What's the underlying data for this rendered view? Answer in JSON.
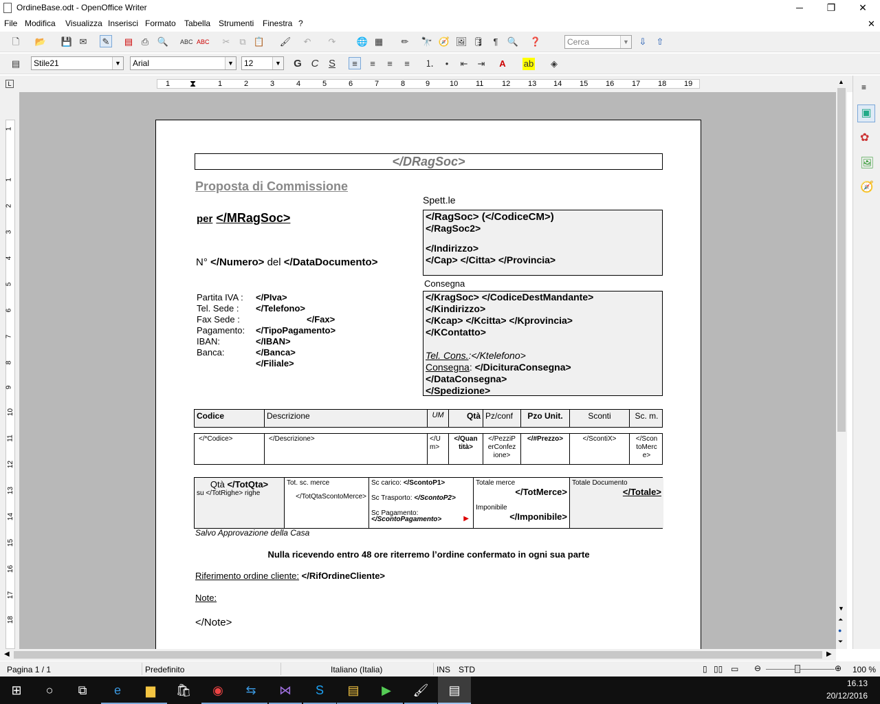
{
  "window": {
    "title": "OrdineBase.odt - OpenOffice Writer",
    "minimize": "─",
    "restore": "❐",
    "close": "✕",
    "doc_close": "✕"
  },
  "menu": [
    {
      "label": "File"
    },
    {
      "label": "Modifica"
    },
    {
      "label": "Visualizza"
    },
    {
      "label": "Inserisci"
    },
    {
      "label": "Formato"
    },
    {
      "label": "Tabella"
    },
    {
      "label": "Strumenti"
    },
    {
      "label": "Finestra"
    },
    {
      "label": "?"
    }
  ],
  "toolbar1": {
    "search_placeholder": "Cerca"
  },
  "toolbar2": {
    "style_value": "Stile21",
    "font_value": "Arial",
    "size_value": "12",
    "bold": "G",
    "italic": "C",
    "underline": "S"
  },
  "ruler": {
    "numbers": [
      "1",
      "1",
      "2",
      "3",
      "4",
      "5",
      "6",
      "7",
      "8",
      "9",
      "10",
      "11",
      "12",
      "13",
      "14",
      "15",
      "16",
      "17",
      "18",
      "19"
    ]
  },
  "vruler": {
    "numbers": [
      "1",
      "1",
      "2",
      "3",
      "4",
      "5",
      "6",
      "7",
      "8",
      "9",
      "10",
      "11",
      "12",
      "13",
      "14",
      "15",
      "16",
      "17",
      "18"
    ]
  },
  "document": {
    "header_field": "</DRagSoc>",
    "proposal_title": "Proposta di Commissione",
    "per_label": "per",
    "per_value": "</MRagSoc>",
    "spett": "Spett.le",
    "customer": {
      "line1": "</RagSoc>  (</CodiceCM>)",
      "line2": "</RagSoc2>",
      "line3": "</Indirizzo>",
      "line4": "</Cap> </Citta> </Provincia>"
    },
    "number_prefix": "N°",
    "number_value": "</Numero>",
    "number_del": "del",
    "number_date": "</DataDocumento>",
    "consegna_label": "Consegna",
    "delivery": {
      "line1": "</KragSoc> </CodiceDestMandante>",
      "line2": "</Kindirizzo>",
      "line3": "</Kcap> </Kcitta> </Kprovincia>",
      "line4": "</KContatto>",
      "tel_label": "Tel. Cons.",
      "tel_value": ":</Ktelefono>",
      "consegna2_label": "Consegna",
      "consegna2_colon": ":",
      "consegna2_value": " </DicituraConsegna>",
      "line7": "</DataConsegna>",
      "line8": "</Spedizione>"
    },
    "info": [
      {
        "label": "Partita IVA :",
        "value": "</PIva>"
      },
      {
        "label": "Tel. Sede :",
        "value": "</Telefono>"
      },
      {
        "label": "Fax Sede :",
        "value": "</Fax>"
      },
      {
        "label": "Pagamento:",
        "value": "</TipoPagamento>"
      },
      {
        "label": "IBAN:",
        "value": "</IBAN>"
      },
      {
        "label": "Banca:",
        "value": "</Banca> </Filiale>"
      }
    ],
    "table_headers": [
      "Codice",
      "Descrizione",
      "UM",
      "Qtà",
      "Pz/conf",
      "Pzo Unit.",
      "Sconti",
      "Sc. m."
    ],
    "table_row": [
      "</*Codice>",
      "</Descrizione>",
      "</U\nm>",
      "</Quan\ntità>",
      "</PezziP\nerConfez\nione>",
      "</#Prezzo>",
      "</ScontiX>",
      "</Scon\ntoMerc\ne>"
    ],
    "totals": {
      "qta_label": "Qtà",
      "qta_value": "</TotQta>",
      "righe": "su </TotRighe> righe",
      "tot_sc_merce": "Tot. sc. merce",
      "tot_qta_sconto": "</TotQtaScontoMerce>",
      "sc_carico_label": "Sc carico:",
      "sc_carico_value": "</ScontoP1>",
      "sc_trasporto_label": "Sc Trasporto:",
      "sc_trasporto_value": "</ScontoP2>",
      "sc_pagamento_label": "Sc Pagamento:",
      "sc_pagamento_value": "</ScontoPagamento>",
      "totale_merce_label": "Totale merce",
      "totale_merce_value": "</TotMerce>",
      "imponibile_label": "Imponibile",
      "imponibile_value": "</Imponibile>",
      "totale_doc_label": "Totale Documento",
      "totale_doc_value": "</Totale>"
    },
    "salvo": "Salvo Approvazione della Casa",
    "notice": "Nulla ricevendo entro 48 ore riterremo l’ordine confermato in ogni sua parte",
    "rif_label": "Riferimento ordine cliente:",
    "rif_value": "</RifOrdineCliente>",
    "note_label": "Note:",
    "note_value": "</Note>"
  },
  "status": {
    "page": "Pagina 1 / 1",
    "style": "Predefinito",
    "language": "Italiano (Italia)",
    "ins": "INS",
    "std": "STD",
    "zoom": "100 %"
  },
  "taskbar": {
    "time": "16.13",
    "date": "20/12/2016"
  }
}
